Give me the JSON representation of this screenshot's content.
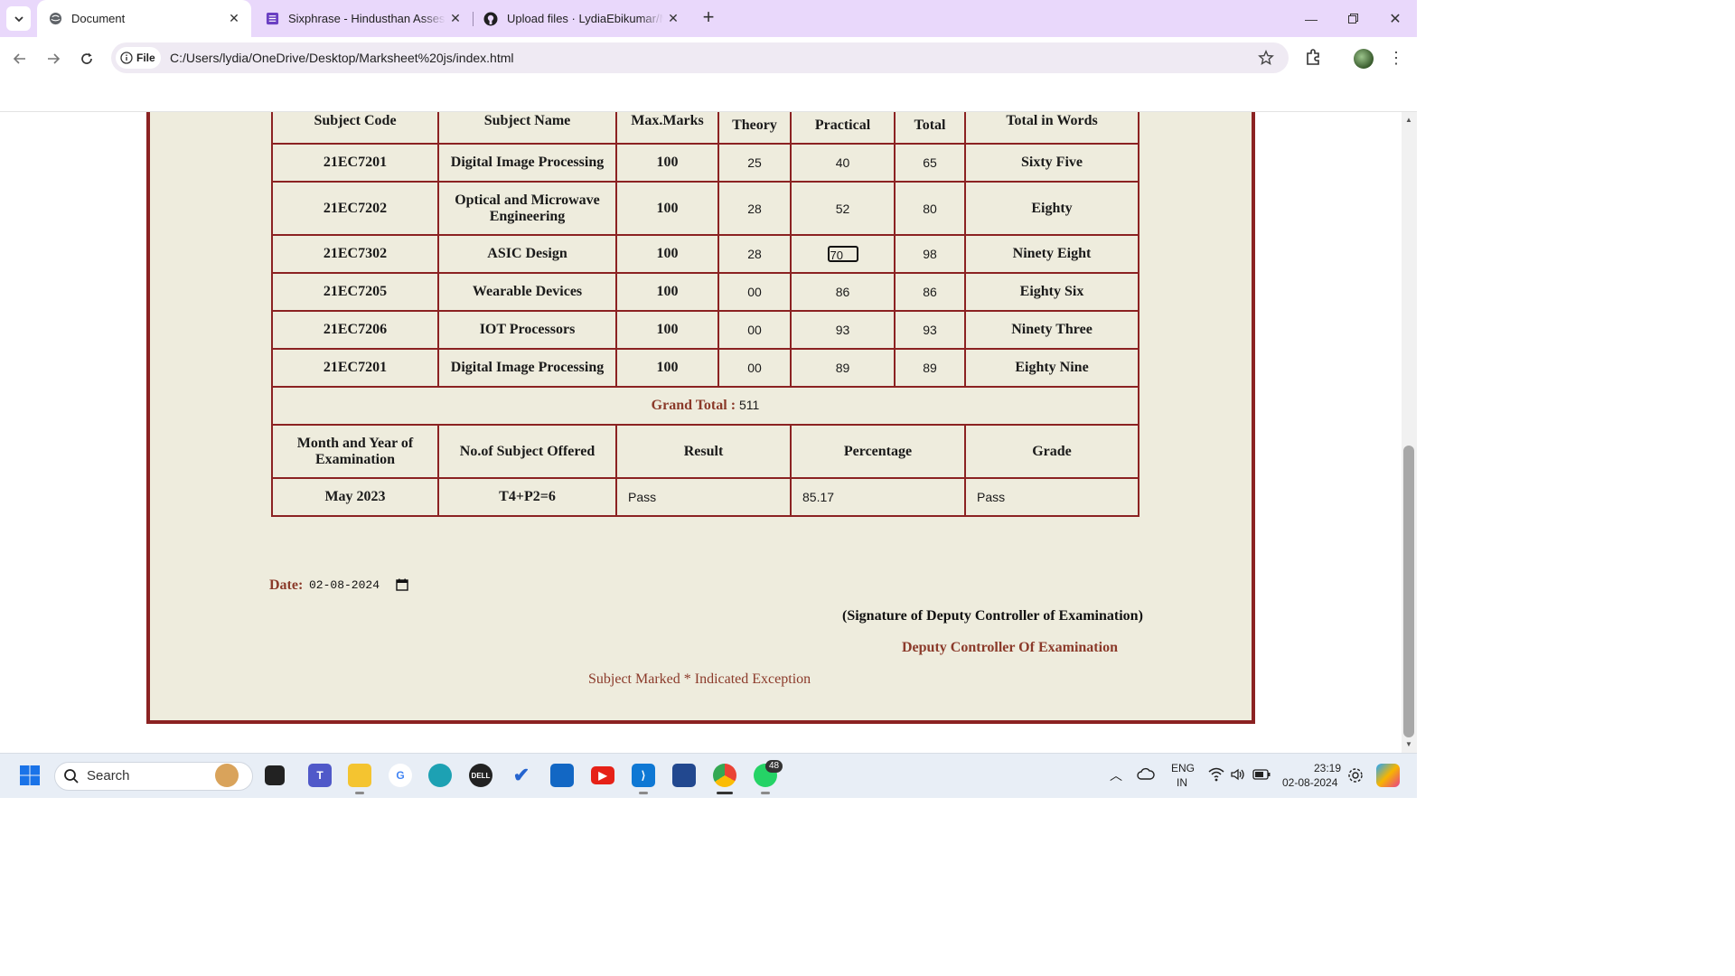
{
  "browser": {
    "tabs": [
      {
        "title": "Document",
        "active": true
      },
      {
        "title": "Sixphrase - Hindusthan Assessment",
        "active": false
      },
      {
        "title": "Upload files · LydiaEbikumar/Marksheet",
        "active": false
      }
    ],
    "new_tab_label": "+",
    "omnibox": {
      "chip": "File",
      "url": "C:/Users/lydia/OneDrive/Desktop/Marksheet%20js/index.html"
    }
  },
  "marksheet": {
    "headers": {
      "subject_code": "Subject Code",
      "subject_name": "Subject Name",
      "max_marks": "Max.Marks",
      "theory": "Theory",
      "practical": "Practical",
      "total": "Total",
      "total_in_words": "Total in Words"
    },
    "rows": [
      {
        "code": "21EC7201",
        "name": "Digital Image Processing",
        "max": "100",
        "theory": "25",
        "practical": "40",
        "total": "65",
        "words": "Sixty Five"
      },
      {
        "code": "21EC7202",
        "name": "Optical and Microwave Engineering",
        "max": "100",
        "theory": "28",
        "practical": "52",
        "total": "80",
        "words": "Eighty"
      },
      {
        "code": "21EC7302",
        "name": "ASIC Design",
        "max": "100",
        "theory": "28",
        "practical": "70",
        "total": "98",
        "words": "Ninety Eight"
      },
      {
        "code": "21EC7205",
        "name": "Wearable Devices",
        "max": "100",
        "theory": "00",
        "practical": "86",
        "total": "86",
        "words": "Eighty Six"
      },
      {
        "code": "21EC7206",
        "name": "IOT Processors",
        "max": "100",
        "theory": "00",
        "practical": "93",
        "total": "93",
        "words": "Ninety Three"
      },
      {
        "code": "21EC7201",
        "name": "Digital Image Processing",
        "max": "100",
        "theory": "00",
        "practical": "89",
        "total": "89",
        "words": "Eighty Nine"
      }
    ],
    "grand_total_label": "Grand Total :",
    "grand_total_value": "511",
    "summary_headers": {
      "month_year": "Month and Year of Examination",
      "subjects_offered": "No.of Subject Offered",
      "result": "Result",
      "percentage": "Percentage",
      "grade": "Grade"
    },
    "summary": {
      "month_year": "May 2023",
      "subjects_offered": "T4+P2=6",
      "result": "Pass",
      "percentage": "85.17",
      "grade": "Pass"
    },
    "date_label": "Date:",
    "date_value": "02-08-2024",
    "signature_line": "(Signature of Deputy Controller of Examination)",
    "controller_title": "Deputy Controller Of Examination",
    "footnote": "Subject Marked * Indicated Exception"
  },
  "taskbar": {
    "search_placeholder": "Search",
    "language": "ENG",
    "region": "IN",
    "time": "23:19",
    "date": "02-08-2024",
    "whatsapp_badge": "48"
  },
  "colors": {
    "accent": "#8b2222",
    "heading": "#8b3a2a",
    "paper": "#eeecdd"
  }
}
